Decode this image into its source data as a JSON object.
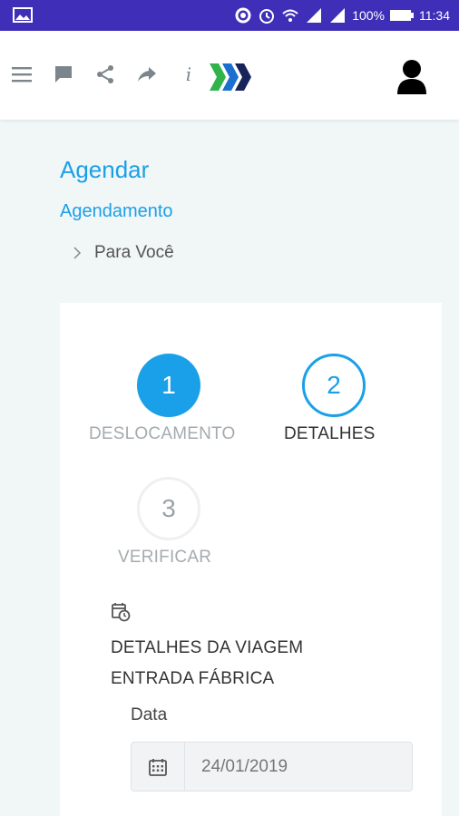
{
  "status_bar": {
    "battery": "100%",
    "time": "11:34"
  },
  "app_bar": {
    "icons": [
      "menu-icon",
      "chat-icon",
      "share-icon",
      "forward-icon",
      "info-icon",
      "logo",
      "user-icon"
    ]
  },
  "page": {
    "title": "Agendar",
    "breadcrumb": "Agendamento",
    "sub_breadcrumb": "Para Você"
  },
  "stepper": {
    "steps": [
      {
        "number": "1",
        "label": "DESLOCAMENTO",
        "state": "completed"
      },
      {
        "number": "2",
        "label": "DETALHES",
        "state": "active"
      },
      {
        "number": "3",
        "label": "VERIFICAR",
        "state": "pending"
      }
    ]
  },
  "details": {
    "line1": "DETALHES DA VIAGEM",
    "line2": "ENTRADA FÁBRICA"
  },
  "date_field": {
    "label": "Data",
    "value": "24/01/2019"
  },
  "colors": {
    "accent": "#1aa0e8",
    "status_bar": "#3f2fb8",
    "background": "#f1f6f7"
  }
}
